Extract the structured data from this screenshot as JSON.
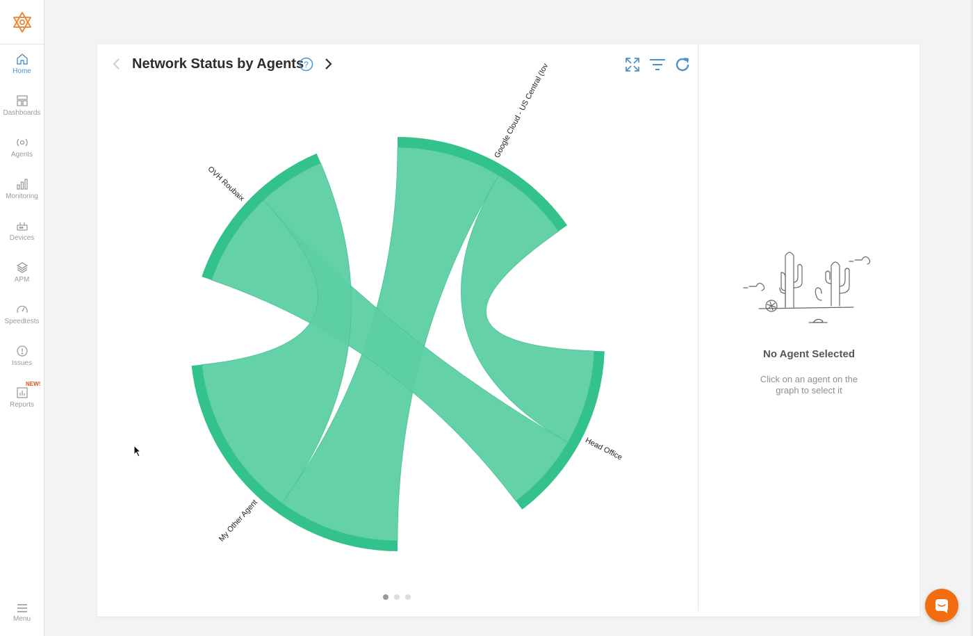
{
  "sidebar": {
    "items": [
      {
        "label": "Home",
        "icon": "home-icon",
        "active": true
      },
      {
        "label": "Dashboards",
        "icon": "dashboard-icon"
      },
      {
        "label": "Agents",
        "icon": "agents-icon"
      },
      {
        "label": "Monitoring",
        "icon": "bar-chart-icon"
      },
      {
        "label": "Devices",
        "icon": "router-icon"
      },
      {
        "label": "APM",
        "icon": "layers-icon"
      },
      {
        "label": "Speedtests",
        "icon": "speedometer-icon"
      },
      {
        "label": "Issues",
        "icon": "alert-icon"
      },
      {
        "label": "Reports",
        "icon": "report-icon",
        "badge": "NEW!"
      }
    ],
    "menu_label": "Menu"
  },
  "panel": {
    "title": "Network Status by Agents",
    "help": "?",
    "tools": [
      "expand-icon",
      "filter-icon",
      "refresh-icon"
    ]
  },
  "chart_data": {
    "type": "chord",
    "nodes": [
      "Google Cloud - US Central (Iov",
      "Head Office",
      "My Other Agent",
      "OVH Roubaix"
    ],
    "links": [
      {
        "source": "Google Cloud - US Central (Iov",
        "target": "My Other Agent"
      },
      {
        "source": "Google Cloud - US Central (Iov",
        "target": "Head Office"
      },
      {
        "source": "Head Office",
        "target": "OVH Roubaix"
      },
      {
        "source": "OVH Roubaix",
        "target": "My Other Agent"
      }
    ],
    "color": "#5ccfa3",
    "arc_color": "#34c28c"
  },
  "pagination": {
    "pages": 3,
    "current": 1
  },
  "empty_state": {
    "title": "No Agent Selected",
    "text": "Click on an agent on the graph to select it"
  },
  "colors": {
    "accent": "#4a90c9",
    "brand": "#f26d10",
    "chord": "#5ccfa3"
  }
}
